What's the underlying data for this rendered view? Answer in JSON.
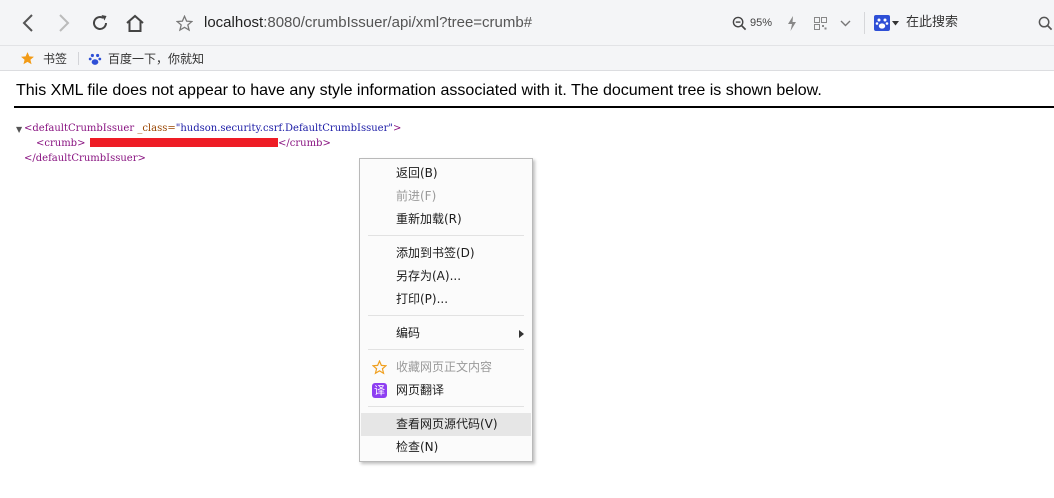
{
  "toolbar": {
    "url_host": "localhost",
    "url_rest": ":8080/crumbIssuer/api/xml?tree=crumb#",
    "zoom": "95%",
    "search_placeholder": "在此搜索"
  },
  "bookmarks": [
    {
      "label": "书签",
      "icon": "star-icon"
    },
    {
      "label": "百度一下，你就知",
      "icon": "baidu-paw-icon"
    }
  ],
  "content": {
    "notice": "This XML file does not appear to have any style information associated with it. The document tree is shown below.",
    "xml": {
      "root_open_tag": "<defaultCrumbIssuer",
      "attr_name": " _class=",
      "attr_value": "\"hudson.security.csrf.DefaultCrumbIssuer\"",
      "root_open_end": ">",
      "child_open": "<crumb>",
      "child_close": "</crumb>",
      "root_close": "</defaultCrumbIssuer>"
    }
  },
  "context_menu": {
    "back": "返回(B)",
    "forward": "前进(F)",
    "reload": "重新加载(R)",
    "add_bookmark": "添加到书签(D)",
    "save_as": "另存为(A)...",
    "print": "打印(P)...",
    "encoding": "编码",
    "collect": "收藏网页正文内容",
    "translate": "网页翻译",
    "translate_icon_char": "译",
    "view_source": "查看网页源代码(V)",
    "inspect": "检查(N)"
  }
}
